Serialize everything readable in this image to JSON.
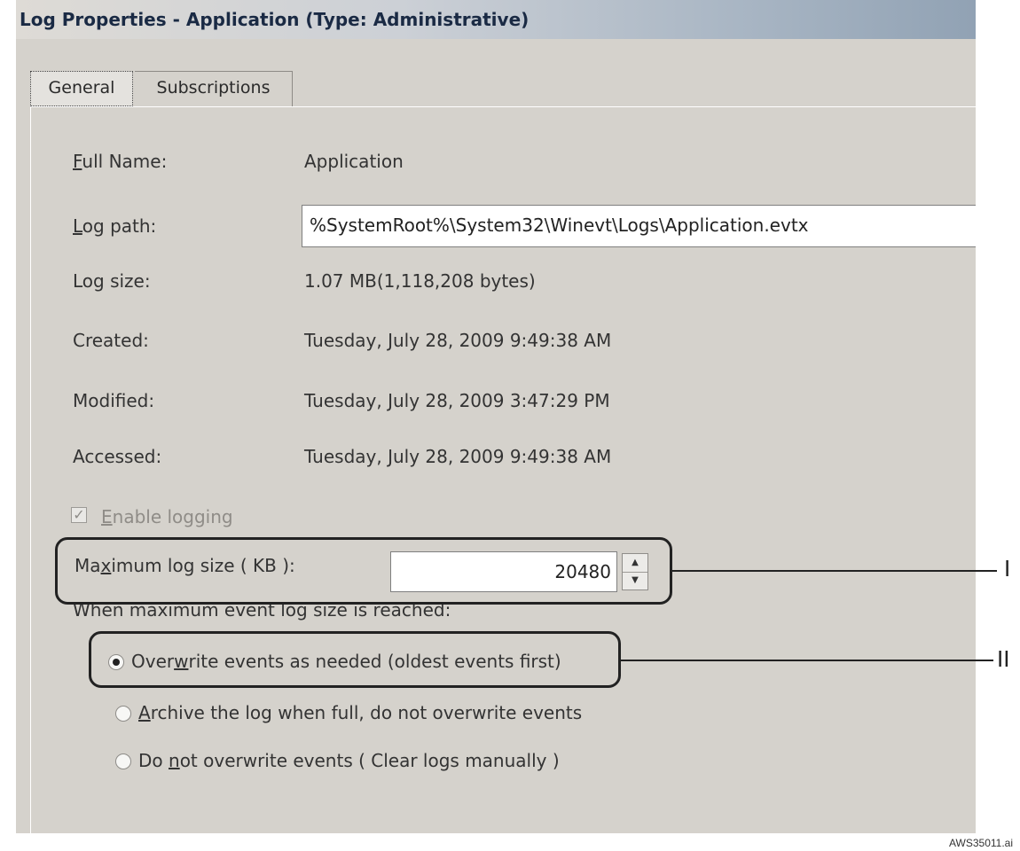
{
  "window": {
    "title": "Log Properties - Application (Type: Administrative)"
  },
  "tabs": [
    {
      "label": "General",
      "selected": true
    },
    {
      "label": "Subscriptions",
      "selected": false
    }
  ],
  "fields": {
    "full_name": {
      "label": "Full Name:",
      "mnemonic": "F",
      "label_rest": "ull Name:",
      "value": "Application"
    },
    "log_path": {
      "label": "Log path:",
      "mnemonic": "L",
      "label_rest": "og path:",
      "value": "%SystemRoot%\\System32\\Winevt\\Logs\\Application.evtx"
    },
    "log_size": {
      "label": "Log size:",
      "value": "1.07 MB(1,118,208 bytes)"
    },
    "created": {
      "label": "Created:",
      "value": "Tuesday, July 28, 2009 9:49:38 AM"
    },
    "modified": {
      "label": "Modified:",
      "value": "Tuesday, July 28, 2009 3:47:29 PM"
    },
    "accessed": {
      "label": "Accessed:",
      "value": "Tuesday, July 28, 2009 9:49:38 AM"
    }
  },
  "enable_logging": {
    "label": "Enable logging",
    "mnemonic": "E",
    "label_rest": "nable logging",
    "checked": true,
    "disabled": true
  },
  "max_log_size": {
    "label": "Maximum log size ( KB ):",
    "label_pre": "Ma",
    "mnemonic": "x",
    "label_rest": "imum log size ( KB ):",
    "value": "20480"
  },
  "when_full": {
    "label": "When maximum event log size is reached:",
    "options": [
      {
        "label": "Overwrite events as needed (oldest events first)",
        "pre": "Over",
        "mnemonic": "w",
        "rest": "rite events as needed (oldest events first)",
        "selected": true
      },
      {
        "label": "Archive the log when full, do not overwrite events",
        "pre": "",
        "mnemonic": "A",
        "rest": "rchive the log when full, do not overwrite events",
        "selected": false
      },
      {
        "label": "Do not overwrite events ( Clear logs manually )",
        "pre": "Do ",
        "mnemonic": "n",
        "rest": "ot overwrite events ( Clear logs manually )",
        "selected": false
      }
    ]
  },
  "callouts": [
    {
      "label": "I"
    },
    {
      "label": "II"
    }
  ],
  "figure_id": "AWS35011.ai",
  "colors": {
    "dialog_bg": "#d5d2cc",
    "title_gradient_end": "#91a2b4",
    "callout": "#222222"
  }
}
